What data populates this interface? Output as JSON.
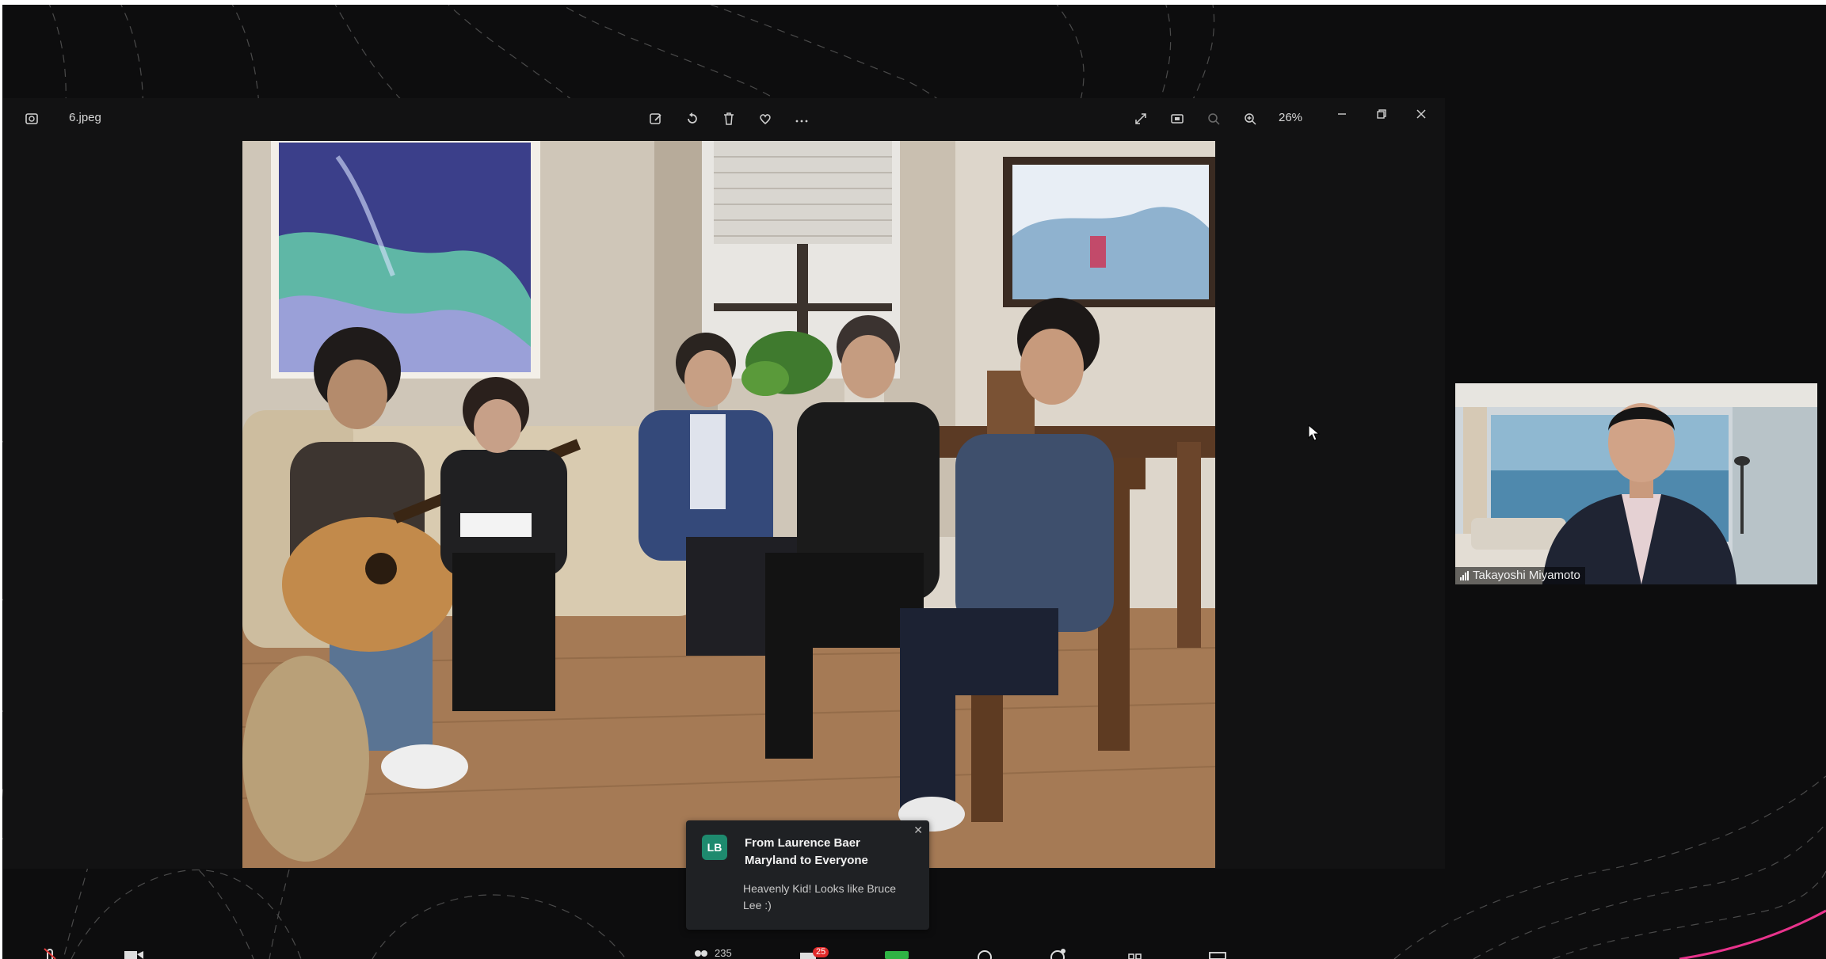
{
  "viewer": {
    "file_name": "6.jpeg",
    "zoom_level": "26%",
    "toolbar_icons": [
      "edit-icon",
      "rotate-icon",
      "delete-icon",
      "favorite-icon",
      "more-icon"
    ],
    "window_icons": [
      "fullscreen-icon",
      "slideshow-icon",
      "zoom-out-icon",
      "zoom-in-icon",
      "minimize-icon",
      "restore-icon",
      "close-icon"
    ]
  },
  "participant": {
    "name": "Takayoshi Miyamoto"
  },
  "chat_toast": {
    "avatar_initials": "LB",
    "from": "From Laurence Baer Maryland to Everyone",
    "message": "Heavenly Kid!   Looks like Bruce Lee :)"
  },
  "toolbar": {
    "participants_count": "235",
    "chat_badge": "25"
  },
  "colors": {
    "accent_pink": "#e8338c",
    "chat_avatar": "#1e8a6e",
    "badge_red": "#e02a2a",
    "share_green": "#2fb344"
  }
}
